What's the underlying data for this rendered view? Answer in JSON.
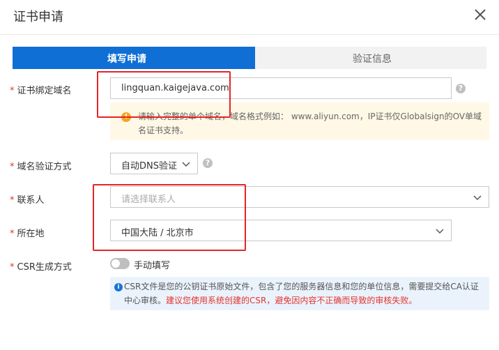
{
  "dialog": {
    "title": "证书申请"
  },
  "steps": [
    {
      "label": "填写申请",
      "active": true
    },
    {
      "label": "验证信息",
      "active": false
    }
  ],
  "form": {
    "domain": {
      "label": "证书绑定域名",
      "value": "lingquan.kaigejava.com",
      "warning": "请输入完整的单个域名，域名格式例如： www.aliyun.com，IP证书仅Globalsign的OV单域名证书支持。"
    },
    "verify_method": {
      "label": "域名验证方式",
      "value": "自动DNS验证"
    },
    "contact": {
      "label": "联系人",
      "placeholder": "请选择联系人"
    },
    "location": {
      "label": "所在地",
      "value": "中国大陆 / 北京市"
    },
    "csr": {
      "label": "CSR生成方式",
      "toggle_label": "手动填写",
      "info_text": "CSR文件是您的公钥证书原始文件，包含了您的服务器信息和您的单位信息，需要提交给CA认证中心审核。",
      "info_warning": "建议您使用系统创建的CSR，避免因内容不正确而导致的审核失败。"
    }
  },
  "colors": {
    "primary": "#0f6fd4",
    "required": "#e5322d",
    "warning_bg": "#fff8e6",
    "info_bg": "#eaf3fc",
    "annotation": "#e32426"
  }
}
